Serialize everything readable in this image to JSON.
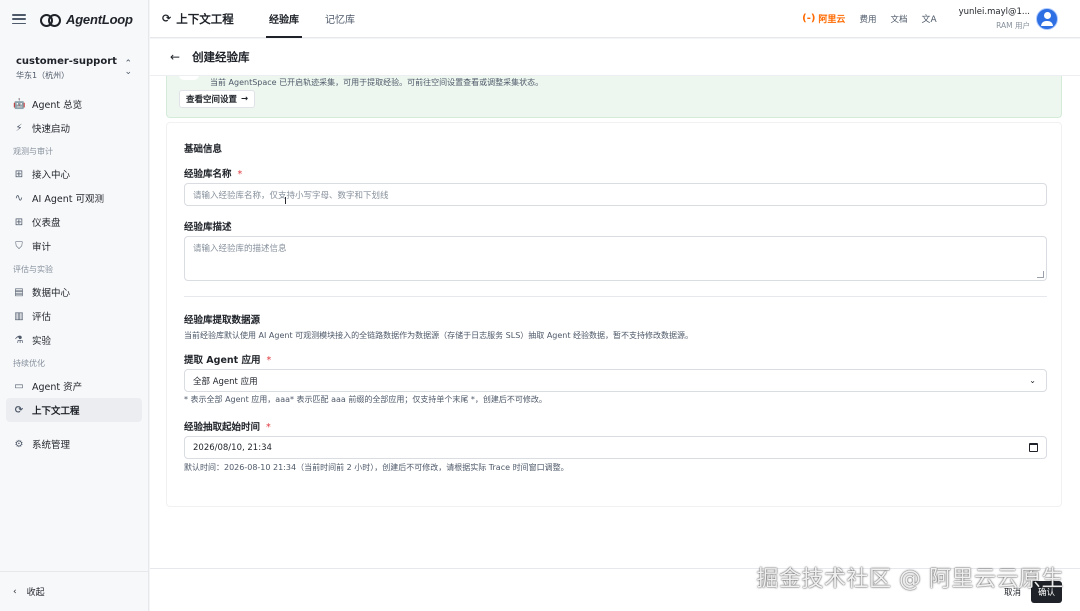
{
  "sidebar": {
    "brand": "AgentLoop",
    "workspace": {
      "name": "customer-support",
      "region": "华东1（杭州）"
    },
    "groups": [
      {
        "title": "",
        "items": [
          {
            "icon": "🤖",
            "label": "Agent 总览"
          },
          {
            "icon": "⚡",
            "label": "快速启动"
          }
        ]
      },
      {
        "title": "观测与审计",
        "items": [
          {
            "icon": "⊞",
            "label": "接入中心"
          },
          {
            "icon": "∿",
            "label": "AI Agent 可观测"
          },
          {
            "icon": "⊞",
            "label": "仪表盘"
          },
          {
            "icon": "⛉",
            "label": "审计"
          }
        ]
      },
      {
        "title": "评估与实验",
        "items": [
          {
            "icon": "▤",
            "label": "数据中心"
          },
          {
            "icon": "▥",
            "label": "评估"
          },
          {
            "icon": "⚗",
            "label": "实验"
          }
        ]
      },
      {
        "title": "持续优化",
        "items": [
          {
            "icon": "▭",
            "label": "Agent 资产"
          },
          {
            "icon": "⟳",
            "label": "上下文工程"
          }
        ]
      }
    ],
    "system": {
      "icon": "⚙",
      "label": "系统管理"
    },
    "collapse": {
      "icon": "‹",
      "label": "收起"
    }
  },
  "header": {
    "title": "上下文工程",
    "tabs": [
      {
        "label": "经验库"
      },
      {
        "label": "记忆库"
      }
    ],
    "aliyun": "阿里云",
    "links": [
      "费用",
      "文档"
    ],
    "user": {
      "name": "yunlei.mayl@1...",
      "role": "RAM 用户"
    }
  },
  "page": {
    "title": "创建经验库"
  },
  "banner": {
    "text": "当前 AgentSpace 已开启轨迹采集，可用于提取经验。可前往空间设置查看或调整采集状态。",
    "button": "查看空间设置"
  },
  "form": {
    "section_basic": "基础信息",
    "name_label": "经验库名称",
    "required_mark": "*",
    "name_placeholder": "请输入经验库名称，仅支持小写字母、数字和下划线",
    "desc_label": "经验库描述",
    "desc_placeholder": "请输入经验库的描述信息",
    "section_source": "经验库提取数据源",
    "source_help": "当前经验库默认使用 AI Agent 可观测模块接入的全链路数据作为数据源（存储于日志服务 SLS）抽取 Agent 经验数据，暂不支持修改数据源。",
    "app_label": "提取 Agent 应用",
    "app_value": "全部 Agent 应用",
    "app_help": "* 表示全部 Agent 应用，aaa* 表示匹配 aaa 前缀的全部应用；仅支持单个末尾 *，创建后不可修改。",
    "time_label": "经验抽取起始时间",
    "time_value": "2026/08/10, 21:34",
    "time_help": "默认时间：2026-08-10 21:34（当前时间前 2 小时），创建后不可修改，请根据实际 Trace 时间窗口调整。"
  },
  "footer": {
    "cancel": "取消",
    "confirm": "确认"
  },
  "watermark": "掘金技术社区 @ 阿里云云原生"
}
